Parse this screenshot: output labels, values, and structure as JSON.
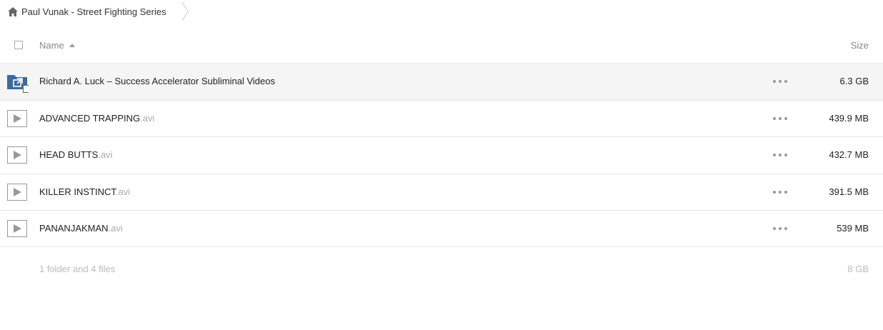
{
  "breadcrumb": {
    "home_icon": "home-icon",
    "label": "Paul Vunak - Street Fighting Series"
  },
  "header": {
    "name_label": "Name",
    "size_label": "Size",
    "sort": "ascending"
  },
  "files": [
    {
      "type": "folder",
      "icon": "shared-folder-icon",
      "name": "Richard A. Luck – Success Accelerator Subliminal Videos",
      "ext": "",
      "size": "6.3 GB",
      "highlighted": true
    },
    {
      "type": "video",
      "icon": "play-icon",
      "name": "ADVANCED TRAPPING",
      "ext": ".avi",
      "size": "439.9 MB"
    },
    {
      "type": "video",
      "icon": "play-icon",
      "name": "HEAD BUTTS",
      "ext": ".avi",
      "size": "432.7 MB"
    },
    {
      "type": "video",
      "icon": "play-icon",
      "name": "KILLER INSTINCT",
      "ext": ".avi",
      "size": "391.5 MB"
    },
    {
      "type": "video",
      "icon": "play-icon",
      "name": "PANANJAKMAN",
      "ext": ".avi",
      "size": "539 MB"
    }
  ],
  "summary": {
    "count_text": "1 folder and 4 files",
    "total_size": "8 GB"
  },
  "colors": {
    "folder_blue": "#3d6a9c",
    "row_highlight": "#f5f5f5",
    "muted_text": "#aaaaaa"
  }
}
